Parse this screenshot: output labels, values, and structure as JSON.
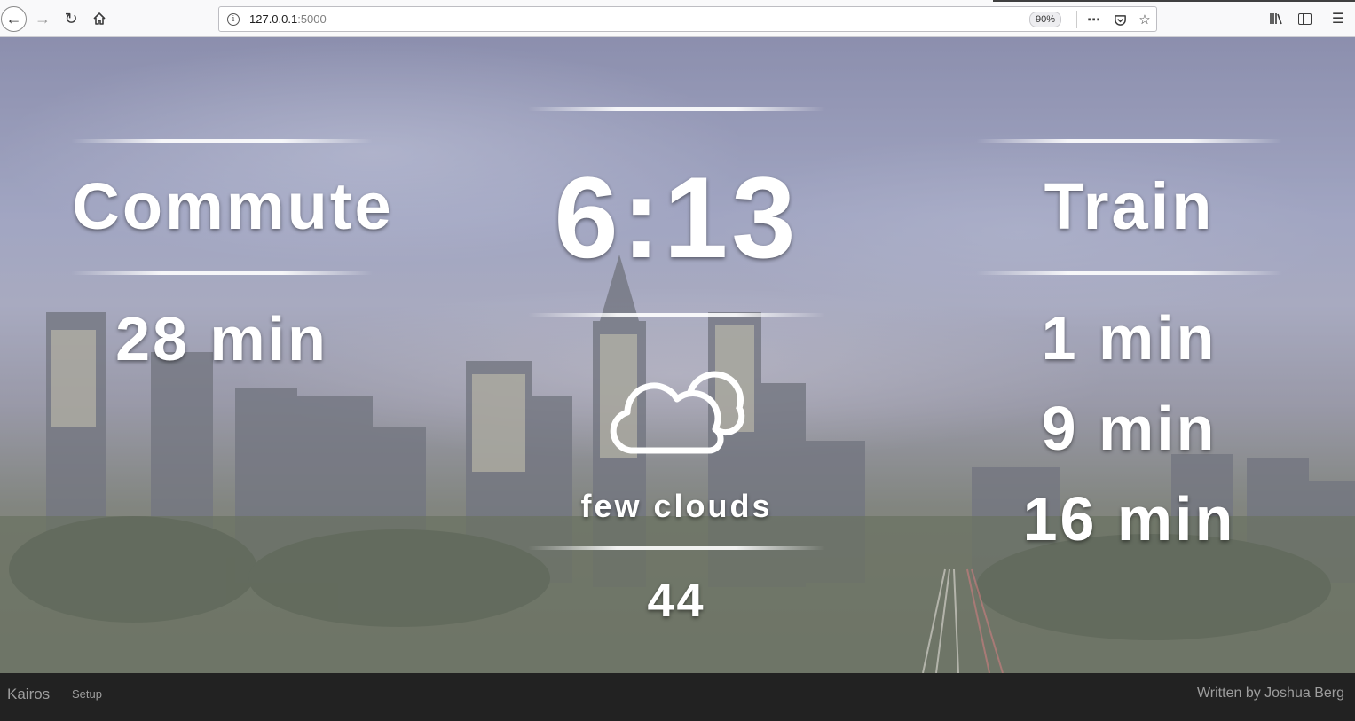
{
  "browser": {
    "url_host": "127.0.0.1",
    "url_port": ":5000",
    "zoom": "90%",
    "icons": [
      "back-icon",
      "forward-icon",
      "reload-icon",
      "home-icon",
      "info-icon",
      "more-icon",
      "pocket-icon",
      "star-icon",
      "library-icon",
      "sidebar-icon",
      "menu-icon"
    ]
  },
  "dashboard": {
    "commute": {
      "title": "Commute",
      "value": "28 min"
    },
    "clock": {
      "time": "6:13"
    },
    "weather": {
      "icon": "cloud-icon",
      "condition": "few clouds",
      "temperature": "44"
    },
    "train": {
      "title": "Train",
      "times": [
        "1 min",
        "9 min",
        "16 min"
      ]
    }
  },
  "footer": {
    "brand": "Kairos",
    "setup": "Setup",
    "credit": "Written by Joshua Berg"
  },
  "colors": {
    "footer_bg": "#222222",
    "footer_text": "#9d9d9d",
    "text": "#ffffff"
  }
}
